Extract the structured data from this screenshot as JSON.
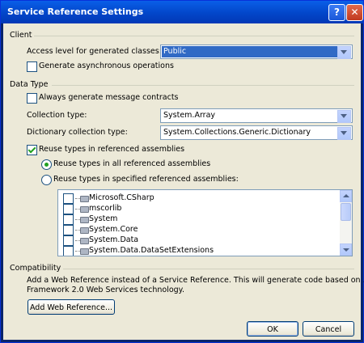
{
  "window": {
    "title": "Service Reference Settings",
    "help_glyph": "?",
    "close_glyph": "✕"
  },
  "client_section": {
    "heading": "Client",
    "access_level_label": "Access level for generated classes:",
    "access_level_value": "Public",
    "async_label": "Generate asynchronous operations",
    "async_checked": false
  },
  "data_type_section": {
    "heading": "Data Type",
    "message_contracts_label": "Always generate message contracts",
    "message_contracts_checked": false,
    "collection_type_label": "Collection type:",
    "collection_type_value": "System.Array",
    "dictionary_type_label": "Dictionary collection type:",
    "dictionary_type_value": "System.Collections.Generic.Dictionary",
    "reuse_types_label": "Reuse types in referenced assemblies",
    "reuse_types_checked": true,
    "reuse_all_label": "Reuse types in all referenced assemblies",
    "reuse_all_selected": true,
    "reuse_specified_label": "Reuse types in specified referenced assemblies:",
    "reuse_specified_selected": false,
    "assemblies": [
      {
        "name": "Microsoft.CSharp",
        "checked": false
      },
      {
        "name": "mscorlib",
        "checked": false
      },
      {
        "name": "System",
        "checked": false
      },
      {
        "name": "System.Core",
        "checked": false
      },
      {
        "name": "System.Data",
        "checked": false
      },
      {
        "name": "System.Data.DataSetExtensions",
        "checked": false
      }
    ]
  },
  "compatibility_section": {
    "heading": "Compatibility",
    "description_line1": "Add a Web Reference instead of a Service Reference. This will generate code based on .NET",
    "description_line2": "Framework 2.0 Web Services technology.",
    "add_web_reference_label": "Add Web Reference..."
  },
  "footer": {
    "ok_label": "OK",
    "cancel_label": "Cancel"
  },
  "colors": {
    "title_bar": "#0246c9",
    "dialog_bg": "#ece9d8",
    "selection": "#316ac5",
    "check_mark": "#21a121"
  }
}
